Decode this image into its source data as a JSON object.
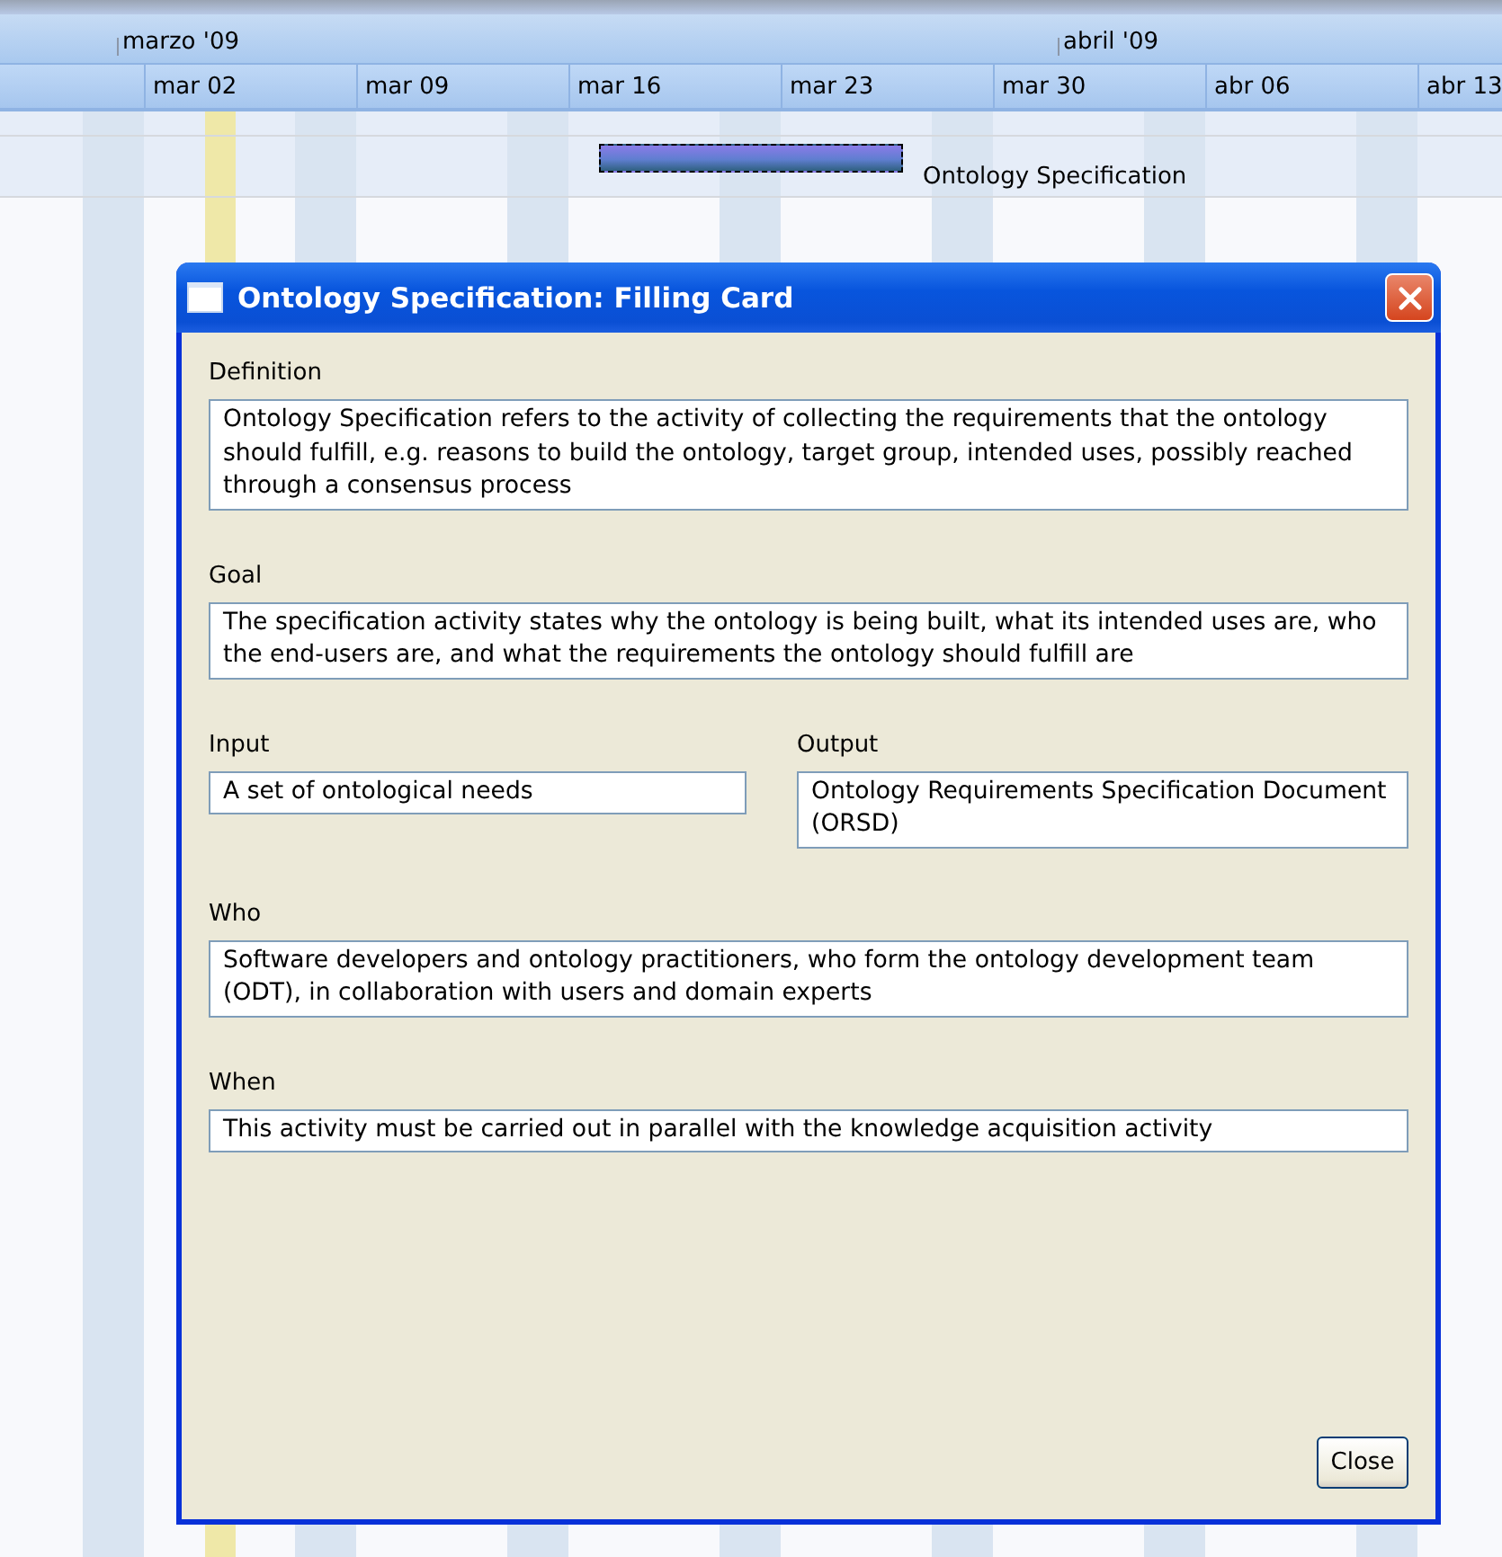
{
  "timeline": {
    "months": [
      {
        "label": "marzo '09"
      },
      {
        "label": "abril '09"
      }
    ],
    "weeks": [
      "mar 02",
      "mar 09",
      "mar 16",
      "mar 23",
      "mar 30",
      "abr 06",
      "abr 13"
    ],
    "task": {
      "name": "Ontology Specification",
      "selected": true
    }
  },
  "dialog": {
    "title": "Ontology Specification: Filling Card",
    "fields": [
      {
        "kind": "full",
        "label": "Definition",
        "value": "Ontology Specification refers to the activity of collecting the requirements that the ontology should fulfill, e.g. reasons to build the ontology, target group, intended uses, possibly reached through a consensus process"
      },
      {
        "kind": "full",
        "label": "Goal",
        "value": "The specification activity states why the ontology is being built, what its intended uses are, who the end-users are, and what the requirements the ontology should fulfill are"
      },
      {
        "kind": "half",
        "label": "Input",
        "value": "A set of ontological needs"
      },
      {
        "kind": "half",
        "label": "Output",
        "value": "Ontology Requirements Specification Document (ORSD)"
      },
      {
        "kind": "full",
        "label": "Who",
        "value": "Software developers and ontology practitioners, who form the ontology development team (ODT), in collaboration with users and domain experts"
      },
      {
        "kind": "full",
        "label": "When",
        "value": "This activity must be carried out in parallel with the knowledge acquisition activity"
      }
    ],
    "button": "Close"
  }
}
